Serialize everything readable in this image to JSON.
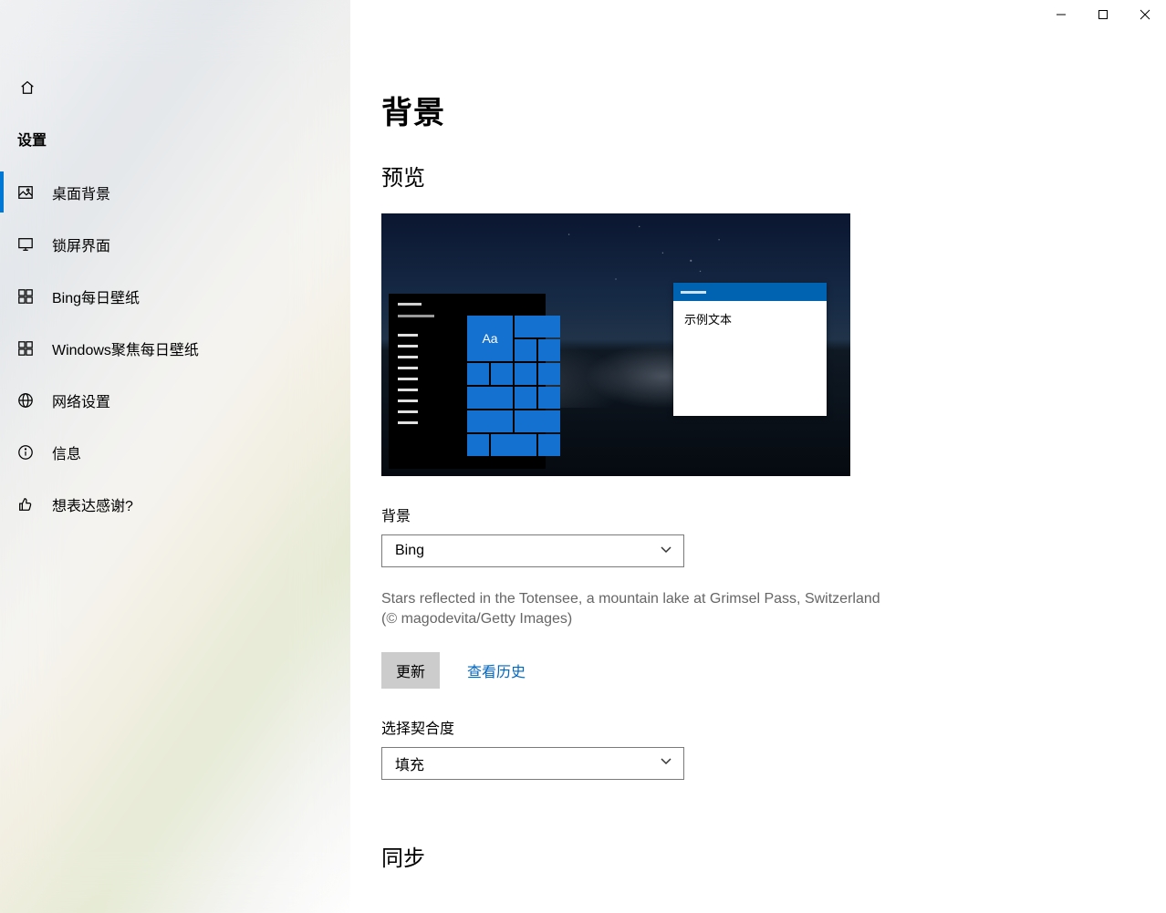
{
  "window": {
    "ctl_min": "–",
    "ctl_max": "▢",
    "ctl_close": "✕"
  },
  "sidebar": {
    "title": "设置",
    "items": [
      {
        "label": "桌面背景"
      },
      {
        "label": "锁屏界面"
      },
      {
        "label": "Bing每日壁纸"
      },
      {
        "label": "Windows聚焦每日壁纸"
      },
      {
        "label": "网络设置"
      },
      {
        "label": "信息"
      },
      {
        "label": "想表达感谢?"
      }
    ]
  },
  "main": {
    "title": "背景",
    "preview_heading": "预览",
    "preview_aa": "Aa",
    "preview_sample_text": "示例文本",
    "bg_field_label": "背景",
    "bg_select_value": "Bing",
    "caption": "Stars reflected in the Totensee, a mountain lake at Grimsel Pass, Switzerland (© magodevita/Getty Images)",
    "refresh_btn": "更新",
    "history_link": "查看历史",
    "fit_field_label": "选择契合度",
    "fit_select_value": "填充",
    "sync_heading": "同步"
  }
}
